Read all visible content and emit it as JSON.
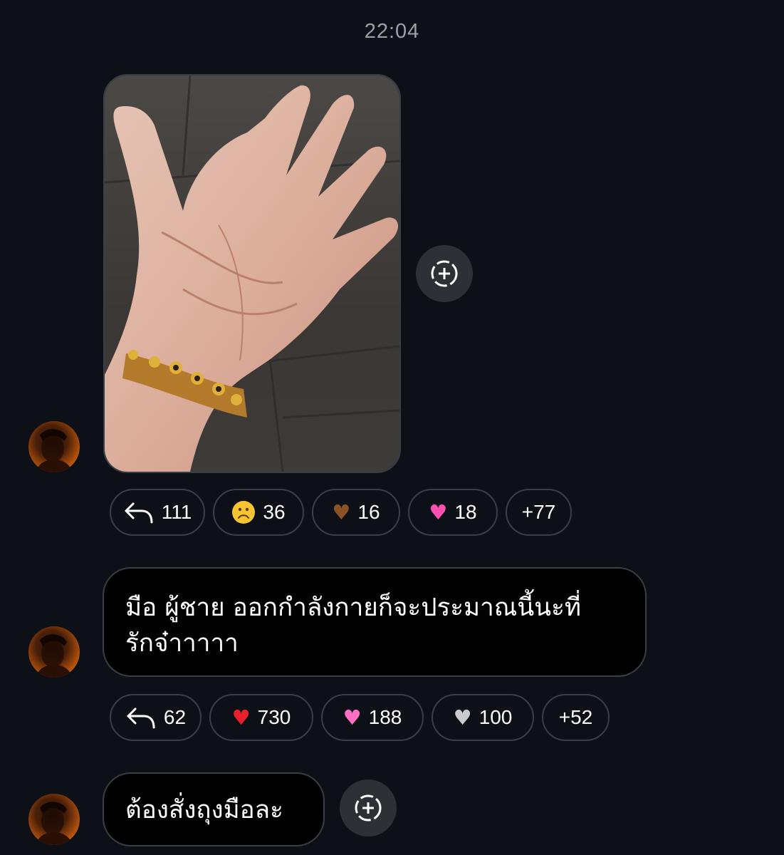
{
  "timestamp": "22:04",
  "messages": [
    {
      "type": "image",
      "image_alt": "hand with gold bracelet",
      "reactions": [
        {
          "icon": "reply-icon",
          "count": "111"
        },
        {
          "icon": "frowning-face-icon",
          "emoji": "☹",
          "count": "36"
        },
        {
          "icon": "brown-heart-icon",
          "emoji": "♥",
          "count": "16"
        },
        {
          "icon": "growing-heart-icon",
          "emoji": "♥",
          "count": "18"
        },
        {
          "icon": "more",
          "count": "+77"
        }
      ]
    },
    {
      "type": "text",
      "text_line1": "มือ ผู้ชาย ออกกำลังกายก็จะประมาณนี้นะที่",
      "text_line2": "รักจ๋าาาาา",
      "reactions": [
        {
          "icon": "reply-icon",
          "count": "62"
        },
        {
          "icon": "red-heart-icon",
          "emoji": "♥",
          "count": "730"
        },
        {
          "icon": "sparkling-heart-icon",
          "emoji": "♥",
          "count": "188"
        },
        {
          "icon": "white-heart-icon",
          "emoji": "♥",
          "count": "100"
        },
        {
          "icon": "more",
          "count": "+52"
        }
      ]
    },
    {
      "type": "text",
      "text": "ต้องสั่งถุงมือละ"
    }
  ],
  "colors": {
    "background": "#0d1117",
    "bubble": "#000000",
    "border": "#3a3f47",
    "add_button": "#2d3136",
    "timestamp": "#9aa0a8"
  }
}
